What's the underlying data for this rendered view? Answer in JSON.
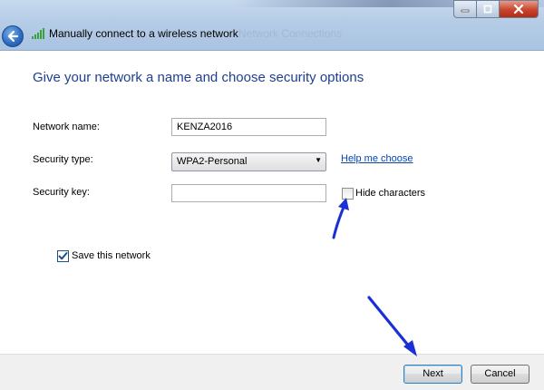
{
  "window": {
    "title": "Manually connect to a wireless network",
    "ghost_title": "Network Connections",
    "caption": {
      "minimize": "–",
      "maximize": "□",
      "close": "✕"
    }
  },
  "page": {
    "heading": "Give your network a name and choose security options"
  },
  "form": {
    "network_name_label": "Network name:",
    "network_name_value": "KENZA2016",
    "security_type_label": "Security type:",
    "security_type_value": "WPA2-Personal",
    "security_key_label": "Security key:",
    "security_key_value": "",
    "help_link": "Help me choose",
    "hide_characters_label": "Hide characters",
    "hide_characters_checked": false,
    "save_network_label": "Save this network",
    "save_network_checked": true
  },
  "footer": {
    "next_label": "Next",
    "cancel_label": "Cancel"
  },
  "colors": {
    "heading": "#1e3f8f",
    "link": "#0645ad",
    "annotation_arrow": "#1a2fd6"
  },
  "icons": {
    "back": "back-arrow-icon",
    "wifi": "wireless-signal-icon",
    "checkmark": "checkmark-icon",
    "dropdown": "chevron-down-icon"
  }
}
